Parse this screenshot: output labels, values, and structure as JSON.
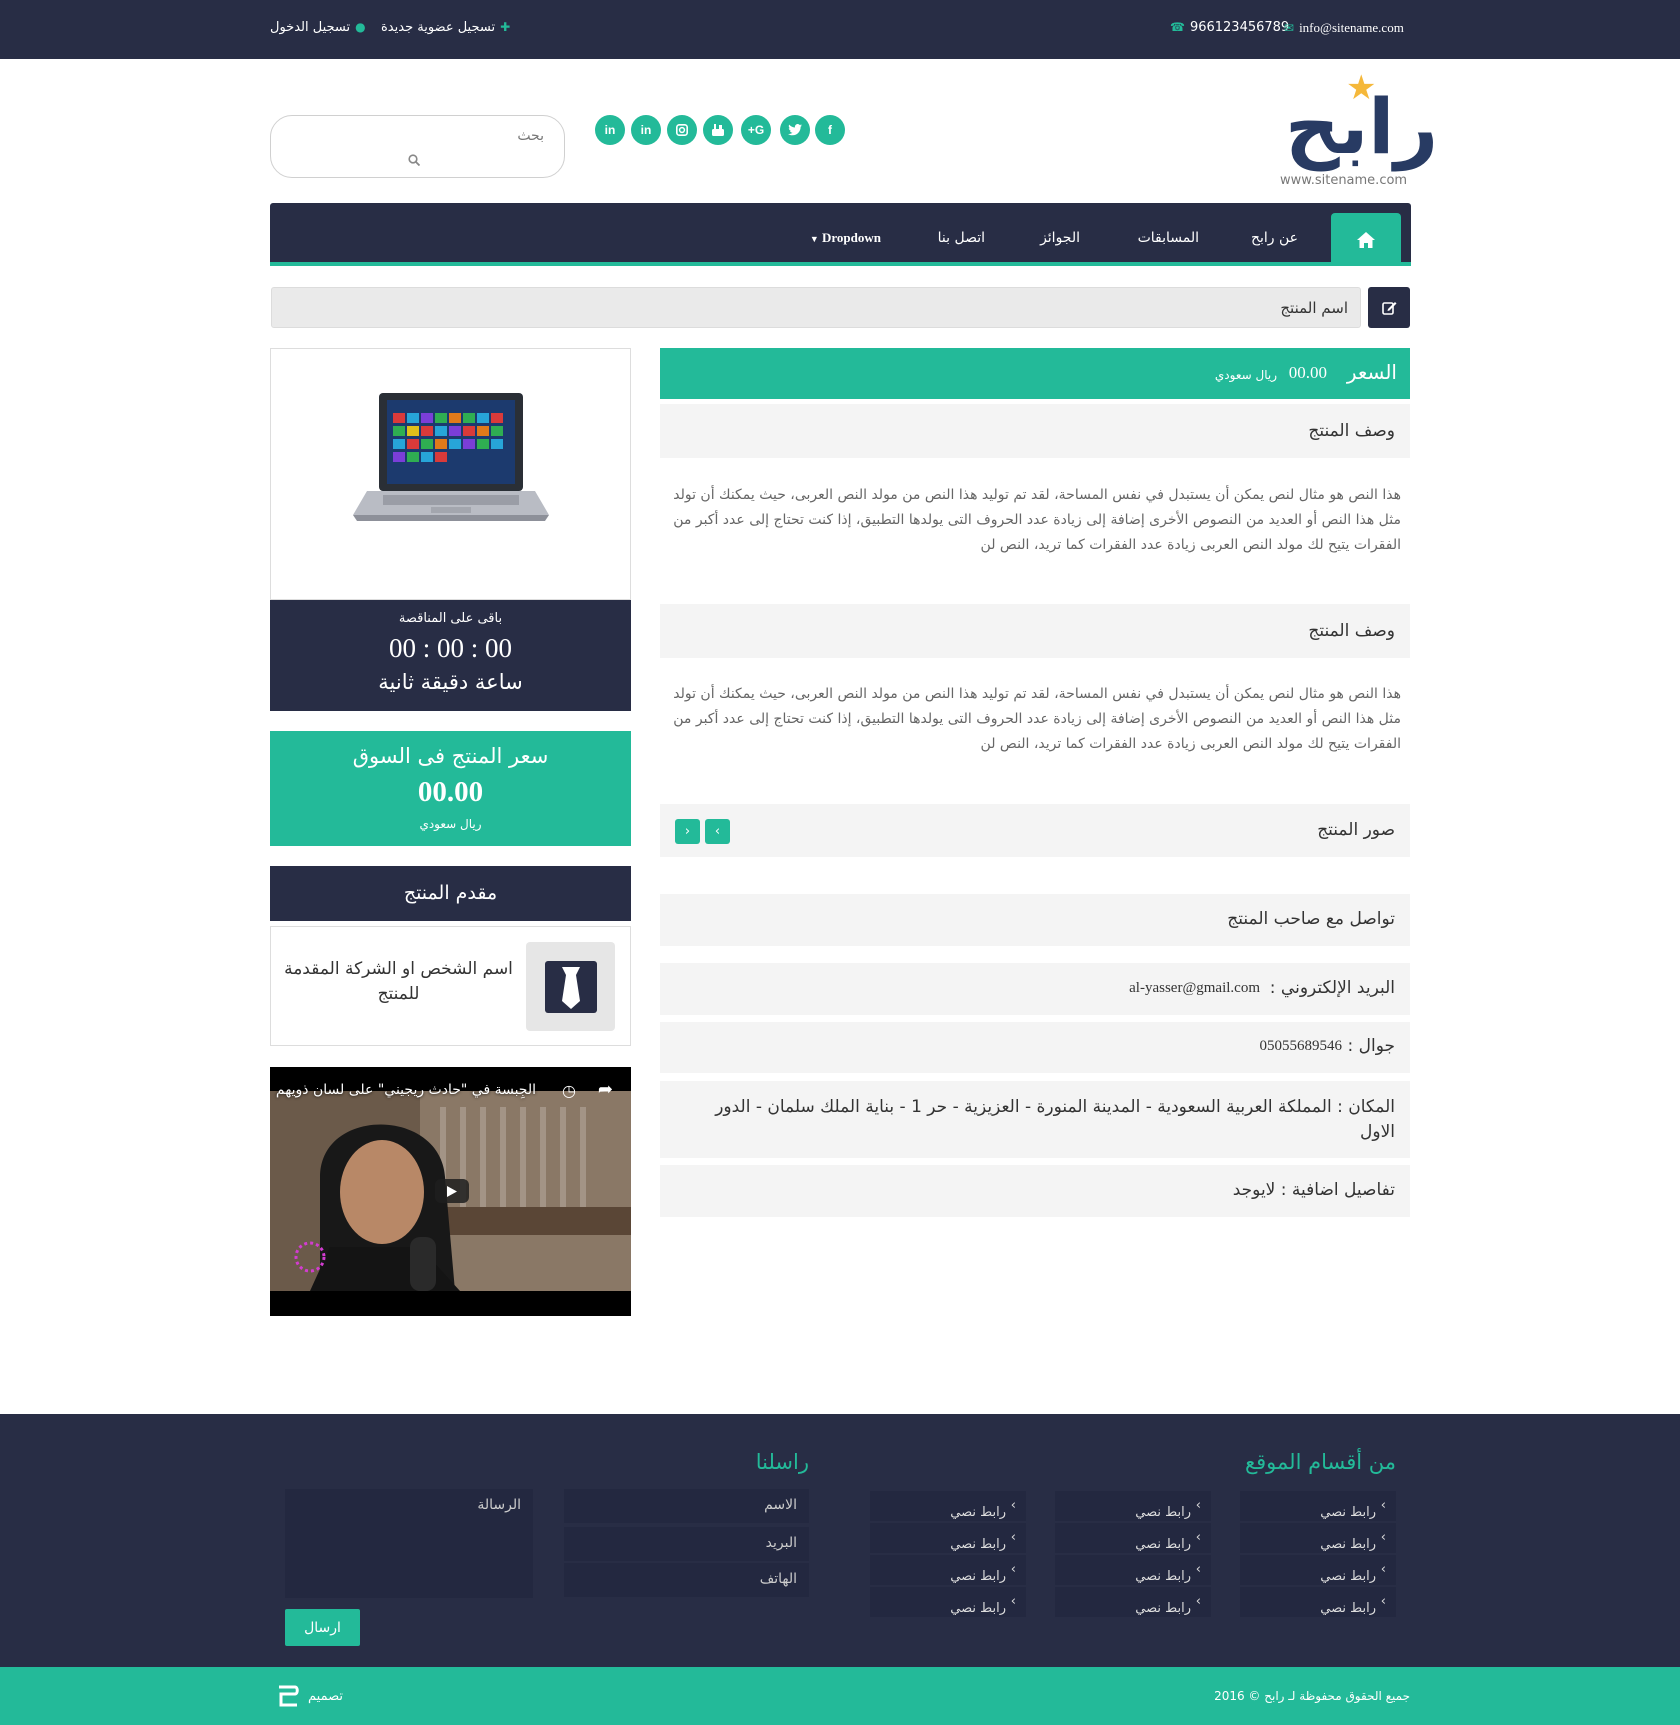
{
  "topbar": {
    "login": "تسجيل الدخول",
    "register": "تسجيل عضوية جديدة",
    "phone": "966123456789",
    "email": "info@sitename.com"
  },
  "header": {
    "logo_text": "رابح",
    "site_url": "www.sitename.com",
    "social": [
      "f",
      "t",
      "G+",
      "yt",
      "ig",
      "in",
      "in"
    ],
    "search_placeholder": "بحث"
  },
  "nav": {
    "items": [
      "عن رابح",
      "المسابقات",
      "الجوائز",
      "اتصل بنا",
      "Dropdown"
    ]
  },
  "product": {
    "name": "اسم المنتج",
    "price_label": "السعر",
    "price_value": "00.00",
    "currency": "ريال سعودي",
    "desc_heading_1": "وصف المنتج",
    "desc_text_1": "هذا النص هو مثال لنص يمكن أن يستبدل في نفس المساحة، لقد تم توليد هذا النص من مولد النص العربى، حيث يمكنك أن تولد مثل هذا النص أو العديد من النصوص الأخرى إضافة إلى زيادة عدد الحروف التى يولدها التطبيق، إذا كنت تحتاج إلى عدد أكبر من الفقرات يتيح لك مولد النص العربى زيادة عدد الفقرات كما تريد، النص لن",
    "desc_heading_2": "وصف المنتج",
    "desc_text_2": "هذا النص هو مثال لنص يمكن أن يستبدل في نفس المساحة، لقد تم توليد هذا النص من مولد النص العربى، حيث يمكنك أن تولد مثل هذا النص أو العديد من النصوص الأخرى إضافة إلى زيادة عدد الحروف التى يولدها التطبيق، إذا كنت تحتاج إلى عدد أكبر من الفقرات يتيح لك مولد النص العربى زيادة عدد الفقرات كما تريد، النص لن",
    "images_heading": "صور المنتج",
    "contact_heading": "تواصل مع صاحب المنتج",
    "email_label": "البريد الإلكتروني :",
    "email_value": "al-yasser@gmail.com",
    "mobile_label": "جوال :",
    "mobile_value": "05055689546",
    "location_label": "المكان :",
    "location_value": "المملكة العربية السعودية - المدينة المنورة - العزيزية - حر 1 - بناية الملك سلمان - الدور الاول",
    "extra_label": "تفاصيل اضافية :",
    "extra_value": "لايوجد"
  },
  "countdown": {
    "title": "باقى على المناقصة",
    "hours": "00",
    "minutes": "00",
    "seconds": "00",
    "separator": ":",
    "units": "ساعة دقيقة ثانية"
  },
  "market": {
    "title": "سعر المنتج فى السوق",
    "value": "00.00",
    "currency": "ريال سعودي"
  },
  "presenter": {
    "heading": "مقدم المنتج",
    "name": "اسم الشخص او الشركة المقدمة للمنتج"
  },
  "video": {
    "title": "الجِبسة في \"حادث ريجيني\" على لسان ذويهم"
  },
  "footer": {
    "sections_heading": "من أقسام الموقع",
    "contact_heading": "راسلنا",
    "link_label": "رابط نصي",
    "name_ph": "الاسم",
    "email_ph": "البريد",
    "phone_ph": "الهاتف",
    "message_ph": "الرسالة",
    "send": "ارسال",
    "copyright": "جميع الحقوق محفوظة لـ رابح © 2016",
    "design": "تصميم"
  },
  "colors": {
    "accent": "#23ba99",
    "dark": "#282d45"
  }
}
